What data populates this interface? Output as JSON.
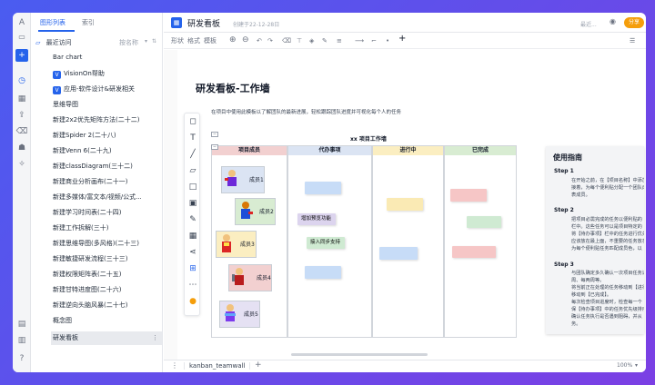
{
  "colors": {
    "accent": "#2563eb",
    "share": "#f59e0b",
    "member_col": "#f2d0d0",
    "todo_col": "#dbe4f3",
    "doing_col": "#fbeec1",
    "done_col": "#d8ecd2"
  },
  "sidebar": {
    "tabs": [
      "图形列表",
      "索引"
    ],
    "recent_label": "最近访问",
    "sort_label": "按名称",
    "items": [
      "Bar chart",
      "VisionOn帮助",
      "应用-软件设计&研发相关",
      "思维导图",
      "新建2x2优先矩阵方法(二十二)",
      "新建Spider 2(二十八)",
      "新建Venn 6(二十九)",
      "新建classDiagram(三十二)",
      "新建商业分析画布(二十一)",
      "新建多媒体/富文本/视频/公式...",
      "新建学习时间表(二十四)",
      "新建工作拆解(三十)",
      "新建思维导图(多风格)(二十三)",
      "新建敏捷研发流程(三十三)",
      "新建权限矩阵表(二十五)",
      "新建甘特进度图(二十六)",
      "新建逆向头脑风暴(二十七)",
      "概念图",
      "研发看板"
    ]
  },
  "header": {
    "title": "研发看板",
    "created": "创建于22-12-28日",
    "recent": "最近...",
    "share_label": "分享"
  },
  "toolbar": {
    "tabs": [
      "形状",
      "格式",
      "模板"
    ]
  },
  "page": {
    "title": "研发看板-工作墙",
    "desc": "在项目中使用此模板以了解团队的最新进展，轻松跟踪团队进度并可视化每个人的任务",
    "board_title": "xx 项目工作墙"
  },
  "board": {
    "columns": [
      "项目成员",
      "代办事项",
      "进行中",
      "已完成"
    ],
    "members": [
      "成员1",
      "成员2",
      "成员3",
      "成员4",
      "成员5"
    ],
    "todo_notes": [
      "增加预览功能",
      "接入同步支持"
    ]
  },
  "guide": {
    "title": "使用指南",
    "steps": [
      {
        "label": "Step 1",
        "lines": [
          "在开始之前，在【项目名称】中添加",
          "接着，为每个便利贴分配一个团队成",
          "表成员。"
        ]
      },
      {
        "label": "Step 2",
        "lines": [
          "把项目必需完成的任务以便利贴的",
          "栏中。这些任务可以是项目特定的",
          "将【待办事项】栏中的任务进行优先",
          "应该放在最上面，不重要的任务放在",
          "为每个便利贴任务匹配成员色，以"
        ]
      },
      {
        "label": "Step 3",
        "lines": [
          "与团队确定多久确认一次项目任务进",
          "周、每两周等。",
          "将当前正在处理的任务移动到【进行",
          "移动到【已完成】。",
          "每次检查项目进度时，检查每一个【",
          "保【待办事项】中的任务优先级排序",
          "确认任务执行是否遇到阻碍，并从【",
          "务。"
        ]
      }
    ]
  },
  "footer": {
    "tab": "kanban_teamwall",
    "zoom": "100%"
  }
}
